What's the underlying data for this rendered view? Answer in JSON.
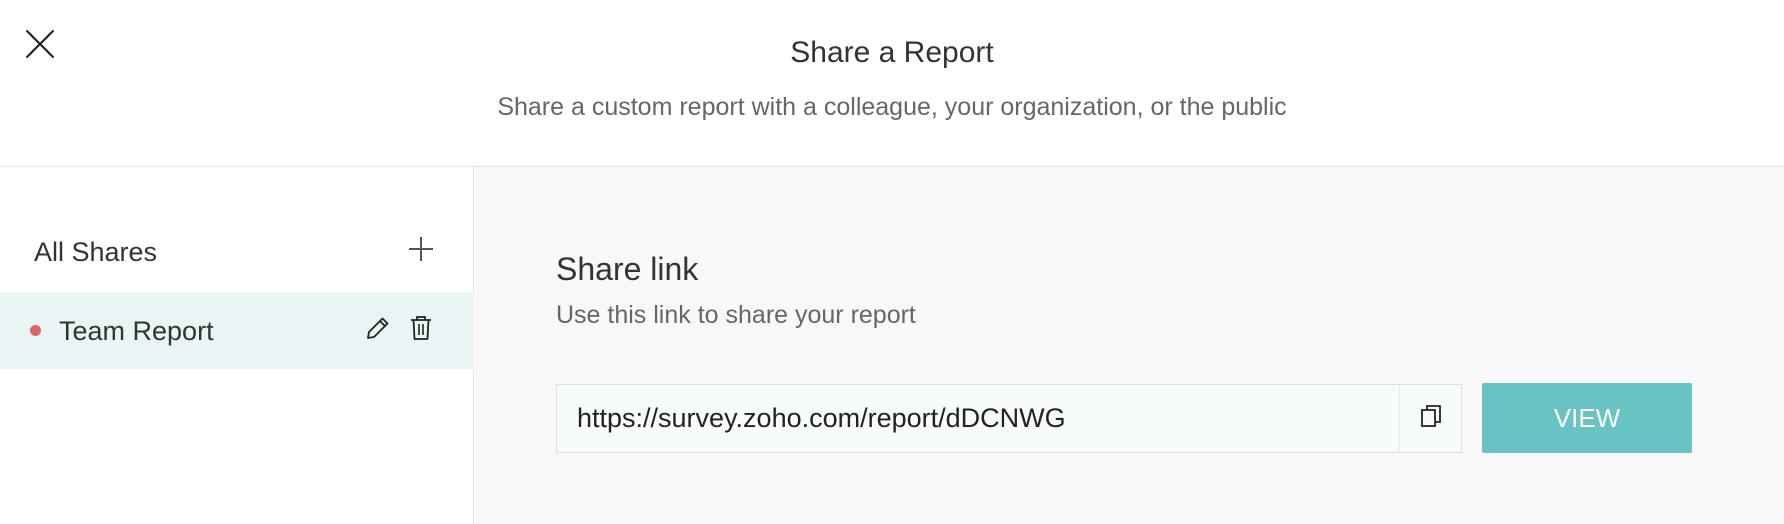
{
  "header": {
    "title": "Share a Report",
    "subtitle": "Share a custom report with a colleague, your organization, or the public",
    "close_icon": "close-icon"
  },
  "sidebar": {
    "heading": "All Shares",
    "add_icon": "plus-icon",
    "items": [
      {
        "label": "Team Report",
        "status_color": "#e06666",
        "edit_icon": "pencil-icon",
        "delete_icon": "trash-icon"
      }
    ]
  },
  "main": {
    "section_title": "Share link",
    "section_description": "Use this link to share your report",
    "share_link": "https://survey.zoho.com/report/dDCNWG",
    "copy_icon": "copy-icon",
    "view_label": "VIEW"
  },
  "colors": {
    "accent": "#6ac3c3",
    "selected_row_bg": "#e9f5f5",
    "main_bg": "#f8f8f8"
  }
}
